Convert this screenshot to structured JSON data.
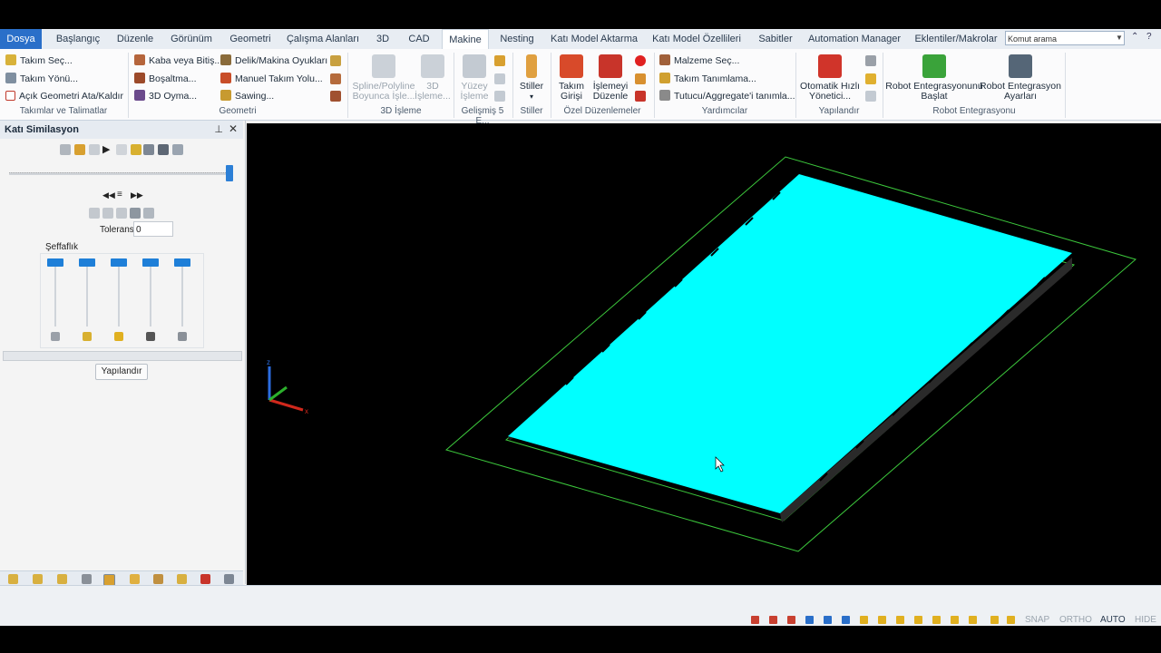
{
  "menu": {
    "tabs": [
      {
        "label": "Dosya"
      },
      {
        "label": "Başlangıç"
      },
      {
        "label": "Düzenle"
      },
      {
        "label": "Görünüm"
      },
      {
        "label": "Geometri"
      },
      {
        "label": "Çalışma Alanları"
      },
      {
        "label": "3D"
      },
      {
        "label": "CAD"
      },
      {
        "label": "Makine"
      },
      {
        "label": "Nesting"
      },
      {
        "label": "Katı Model Aktarma"
      },
      {
        "label": "Katı Model Özellileri"
      },
      {
        "label": "Sabitler"
      },
      {
        "label": "Automation Manager"
      },
      {
        "label": "Eklentiler/Makrolar"
      }
    ],
    "active_tab": "Makine",
    "search_placeholder": "Komut arama"
  },
  "ribbon": {
    "groups": {
      "tools": {
        "title": "Takımlar ve Talimatlar",
        "items": [
          "Takım Seç...",
          "Takım Yönü...",
          "Açık Geometri Ata/Kaldır"
        ]
      },
      "geometry": {
        "title": "Geometri",
        "items": [
          "Kaba veya Bitiş...",
          "Boşaltma...",
          "3D Oyma...",
          "Delik/Makina Oyukları",
          "Manuel Takım Yolu...",
          "Sawing..."
        ]
      },
      "machining3d": {
        "title": "3D İşleme",
        "items": [
          "Spline/Polyline Boyunca İşle...",
          "3D İşleme..."
        ]
      },
      "adv5": {
        "title": "Gelişmiş 5 E...",
        "items": [
          "Yüzey İşleme"
        ]
      },
      "styles": {
        "title": "Stiller",
        "items": [
          "Stiller"
        ]
      },
      "special": {
        "title": "Özel Düzenlemeler",
        "items": [
          "Takım Girişi",
          "İşlemeyi Düzenle"
        ]
      },
      "helpers": {
        "title": "Yardımcılar",
        "items": [
          "Malzeme Seç...",
          "Takım Tanımlama...",
          "Tutucu/Aggregate'i tanımla..."
        ]
      },
      "configure": {
        "title": "Yapılandır",
        "items": [
          "Otomatik Hızlı Yönetici..."
        ]
      },
      "robot": {
        "title": "Robot Entegrasyonu",
        "items": [
          "Robot Entegrasyonunu Başlat",
          "Robot Entegrasyon Ayarları"
        ]
      }
    }
  },
  "panel": {
    "title": "Katı Similasyon",
    "tolerance_label": "Tolerans",
    "tolerance_value": "0",
    "transparency_label": "Şeffaflık",
    "configure_button": "Yapılandır"
  },
  "viewport": {
    "background": "#000000",
    "stock_color": "#00FFFF",
    "boundary_color": "#3CC83C"
  },
  "status": {
    "modes": [
      "SNAP",
      "ORTHO",
      "AUTO",
      "HIDE"
    ]
  },
  "colors": {
    "accent": "#2A6FC9",
    "slider": "#1E7FD8"
  }
}
